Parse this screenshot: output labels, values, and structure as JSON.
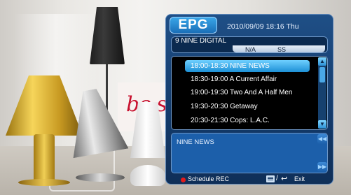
{
  "background": {
    "banner_text": "be st"
  },
  "epg": {
    "title": "EPG",
    "datetime": "2010/09/09 18:16 Thu",
    "channel": {
      "name": "9 NINE DIGITAL",
      "info_left": "N/A",
      "info_right": "SS"
    },
    "programs": [
      {
        "label": "18:00-18:30 NINE NEWS",
        "selected": true
      },
      {
        "label": "18:30-19:00 A Current Affair",
        "selected": false
      },
      {
        "label": "19:00-19:30 Two And A Half Men",
        "selected": false
      },
      {
        "label": "19:30-20:30 Getaway",
        "selected": false
      },
      {
        "label": "20:30-21:30 Cops: L.A.C.",
        "selected": false
      }
    ],
    "description": "NINE NEWS",
    "footer": {
      "schedule_label": "Schedule REC",
      "exit_label": "Exit",
      "slash": "/",
      "back_glyph": "↩"
    },
    "icons": {
      "scroll_up": "▲",
      "scroll_down": "▼",
      "page_up": "◀◀",
      "page_down": "▶▶"
    },
    "colors": {
      "panel": "#133a6a",
      "selection": "#1e90d6",
      "record_dot": "#e31b1b"
    }
  }
}
